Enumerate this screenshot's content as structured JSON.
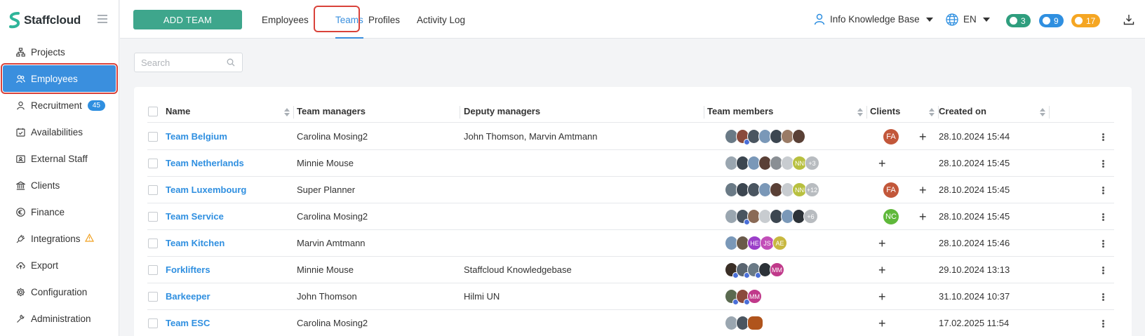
{
  "app": {
    "name": "Staffcloud"
  },
  "sidebar": {
    "items": [
      {
        "label": "Projects",
        "icon": "sitemap-icon"
      },
      {
        "label": "Employees",
        "icon": "users-icon",
        "active": true
      },
      {
        "label": "Recruitment",
        "icon": "user-icon",
        "badge": "45"
      },
      {
        "label": "Availabilities",
        "icon": "calendar-check-icon"
      },
      {
        "label": "External Staff",
        "icon": "id-card-icon"
      },
      {
        "label": "Clients",
        "icon": "bank-icon"
      },
      {
        "label": "Finance",
        "icon": "euro-icon"
      },
      {
        "label": "Integrations",
        "icon": "plug-icon",
        "warning": true
      },
      {
        "label": "Export",
        "icon": "cloud-upload-icon"
      },
      {
        "label": "Configuration",
        "icon": "gear-icon"
      },
      {
        "label": "Administration",
        "icon": "wrench-icon"
      }
    ]
  },
  "topbar": {
    "add_team_label": "ADD TEAM",
    "tabs": [
      {
        "label": "Employees"
      },
      {
        "label": "Teams",
        "active": true
      },
      {
        "label": "Profiles"
      },
      {
        "label": "Activity Log"
      }
    ],
    "knowledge_base": "Info Knowledge Base",
    "language": "EN",
    "counters": [
      {
        "value": "3",
        "icon": "chat-icon",
        "color": "#2f9e7e"
      },
      {
        "value": "9",
        "icon": "bell-icon",
        "color": "#2f8fe0"
      },
      {
        "value": "17",
        "icon": "clock-icon",
        "color": "#f5a623"
      }
    ]
  },
  "search": {
    "placeholder": "Search"
  },
  "table": {
    "columns": [
      "Name",
      "Team managers",
      "Deputy managers",
      "Team members",
      "Clients",
      "Created on"
    ],
    "rows": [
      {
        "name": "Team Belgium",
        "managers": "Carolina Mosing2",
        "deputy": "John Thomson, Marvin Amtmann",
        "members_more": "",
        "client": "FA",
        "client_color": "#c2573a",
        "created": "28.10.2024 15:44"
      },
      {
        "name": "Team Netherlands",
        "managers": "Minnie Mouse",
        "deputy": "",
        "members_more": "+3",
        "client": "",
        "client_color": "",
        "created": "28.10.2024 15:45"
      },
      {
        "name": "Team Luxembourg",
        "managers": "Super Planner",
        "deputy": "",
        "members_more": "+12",
        "client": "FA",
        "client_color": "#c2573a",
        "created": "28.10.2024 15:45"
      },
      {
        "name": "Team Service",
        "managers": "Carolina Mosing2",
        "deputy": "",
        "members_more": "+6",
        "client": "NC",
        "client_color": "#5fb83a",
        "created": "28.10.2024 15:45"
      },
      {
        "name": "Team Kitchen",
        "managers": "Marvin Amtmann",
        "deputy": "",
        "members_more": "",
        "client": "",
        "client_color": "",
        "created": "28.10.2024 15:46"
      },
      {
        "name": "Forklifters",
        "managers": "Minnie Mouse",
        "deputy": "Staffcloud Knowledgebase",
        "members_more": "",
        "client": "",
        "client_color": "",
        "created": "29.10.2024 13:13"
      },
      {
        "name": "Barkeeper",
        "managers": "John Thomson",
        "deputy": "Hilmi UN",
        "members_more": "",
        "client": "",
        "client_color": "",
        "created": "31.10.2024 10:37"
      },
      {
        "name": "Team ESC",
        "managers": "Carolina Mosing2",
        "deputy": "",
        "members_more": "",
        "client": "",
        "client_color": "",
        "created": "17.02.2025 11:54"
      }
    ],
    "member_initials": {
      "netherlands": "NN",
      "luxembourg": "NN",
      "kitchen": [
        "HE",
        "JS",
        "AE"
      ],
      "forklifters": "MM",
      "barkeeper": "MM"
    }
  }
}
